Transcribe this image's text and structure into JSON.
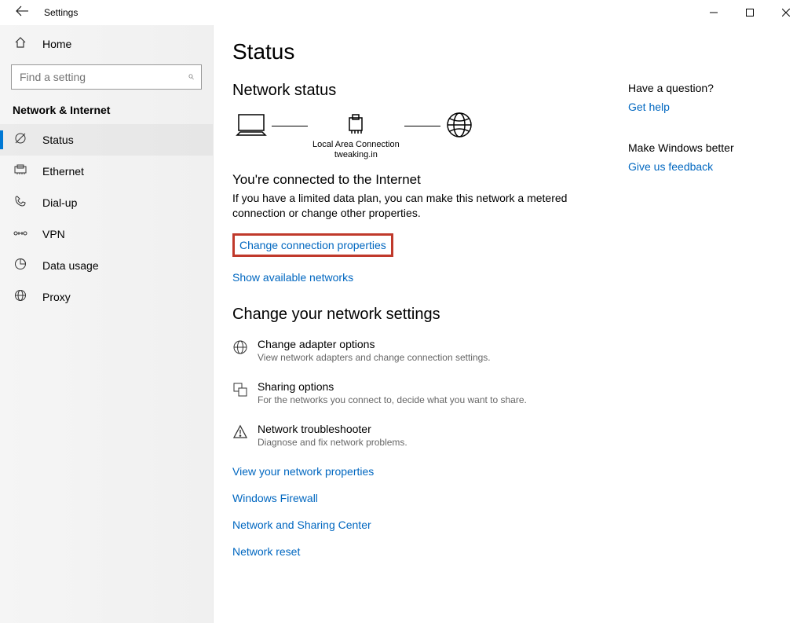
{
  "window": {
    "title": "Settings"
  },
  "sidebar": {
    "home": "Home",
    "search_placeholder": "Find a setting",
    "category": "Network & Internet",
    "items": [
      {
        "icon": "status",
        "label": "Status"
      },
      {
        "icon": "ethernet",
        "label": "Ethernet"
      },
      {
        "icon": "dialup",
        "label": "Dial-up"
      },
      {
        "icon": "vpn",
        "label": "VPN"
      },
      {
        "icon": "datausage",
        "label": "Data usage"
      },
      {
        "icon": "proxy",
        "label": "Proxy"
      }
    ]
  },
  "main": {
    "title": "Status",
    "section": "Network status",
    "diagram": {
      "conn_name": "Local Area Connection",
      "conn_domain": "tweaking.in"
    },
    "connected_head": "You're connected to the Internet",
    "connected_desc": "If you have a limited data plan, you can make this network a metered connection or change other properties.",
    "link_change_props": "Change connection properties",
    "link_show_networks": "Show available networks",
    "change_heading": "Change your network settings",
    "settings": [
      {
        "title": "Change adapter options",
        "sub": "View network adapters and change connection settings."
      },
      {
        "title": "Sharing options",
        "sub": "For the networks you connect to, decide what you want to share."
      },
      {
        "title": "Network troubleshooter",
        "sub": "Diagnose and fix network problems."
      }
    ],
    "links": [
      "View your network properties",
      "Windows Firewall",
      "Network and Sharing Center",
      "Network reset"
    ]
  },
  "right": {
    "q_head": "Have a question?",
    "q_link": "Get help",
    "f_head": "Make Windows better",
    "f_link": "Give us feedback"
  }
}
